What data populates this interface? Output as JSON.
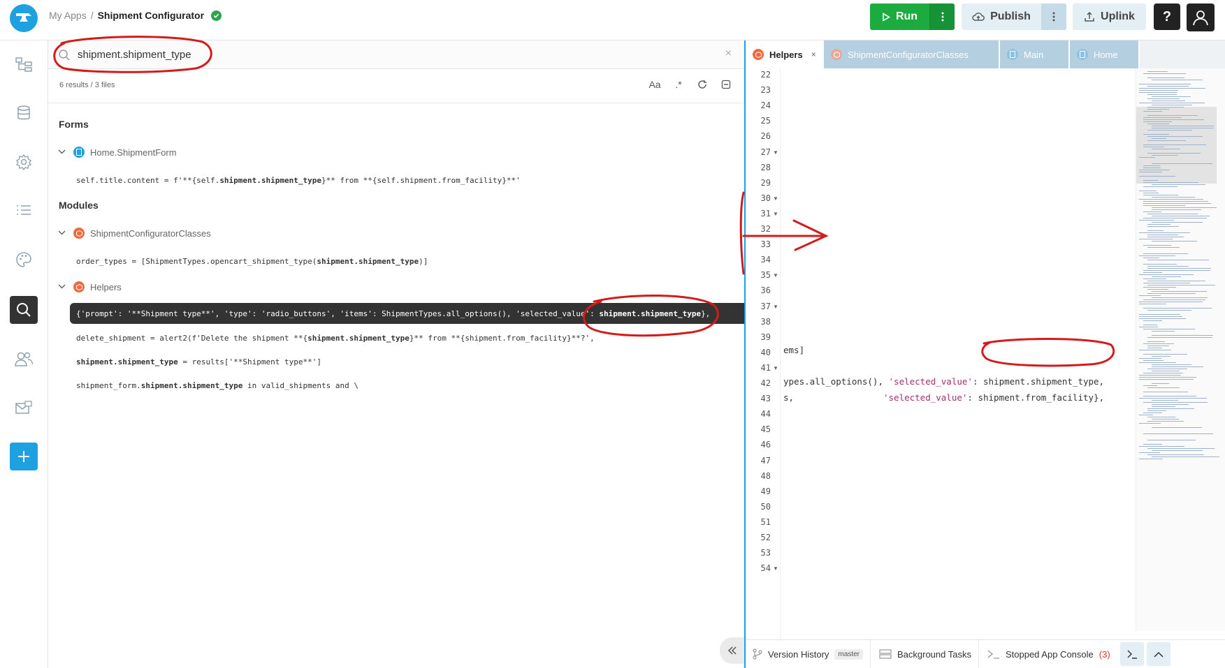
{
  "header": {
    "breadcrumb_root": "My Apps",
    "breadcrumb_sep": "/",
    "app_name": "Shipment Configurator",
    "run_label": "Run",
    "publish_label": "Publish",
    "uplink_label": "Uplink",
    "help_label": "?"
  },
  "search": {
    "query": "shipment.shipment_type",
    "results_summary": "6 results / 3 files",
    "match_case_label": "Aa",
    "regex_label": ".*",
    "sections": {
      "forms": "Forms",
      "modules": "Modules"
    },
    "files": {
      "home_form": "Home.ShipmentForm",
      "classes": "ShipmentConfiguratorClasses",
      "helpers": "Helpers"
    },
    "matches": {
      "m1_a": "self.title.content = f'**{self.",
      "m1_b": "shipment.shipment_type",
      "m1_c": "}** from **{self.shipment.from_facility}**'",
      "m2_a": "order_types = [ShipmentTypes.opencart_shipment_type(",
      "m2_b": "shipment.shipment_type",
      "m2_c": ")]",
      "m3_a": "{'prompt': '**Shipment type**', 'type': 'radio_buttons', 'items': ShipmentTypes.all_options(), 'selected_value': ",
      "m3_b": "shipment.shipment_type",
      "m3_c": "},",
      "m4_a": "delete_shipment = alert2(f'Delete the shipment **{",
      "m4_b": "shipment.shipment_type",
      "m4_c": "}** from **{shipment.from_facility}**?',",
      "m5_b": "shipment.shipment_type",
      "m5_c": " = results['**Shipment type**']",
      "m6_a": "shipment_form.",
      "m6_b": "shipment.shipment_type",
      "m6_c": " in valid_shipments and \\"
    }
  },
  "editor": {
    "tabs": [
      "Helpers",
      "ShipmentConfiguratorClasses",
      "Main",
      "Home"
    ],
    "close_glyph": "×",
    "line_numbers": [
      "22",
      "23",
      "24",
      "25",
      "26",
      "27",
      "28",
      "29",
      "30",
      "31",
      "32",
      "33",
      "34",
      "35",
      "36",
      "37",
      "38",
      "39",
      "40",
      "41",
      "42",
      "43",
      "44",
      "45",
      "46",
      "47",
      "48",
      "49",
      "50",
      "51",
      "52",
      "53",
      "54"
    ],
    "code": {
      "l36": "ems]",
      "l38_a": "ypes.all_options(), ",
      "l38_b": "'selected_value'",
      "l38_c": ": shipment.shipment_type,",
      "l39_a": "s,                 ",
      "l39_b": "'selected_value'",
      "l39_c": ": shipment.from_facility},"
    }
  },
  "statusbar": {
    "version_history": "Version History",
    "branch": "master",
    "background_tasks": "Background Tasks",
    "console": "Stopped App Console",
    "console_count": "(3)"
  },
  "colors": {
    "accent": "#1da1e0",
    "run_green": "#1cab3f",
    "annotation_red": "#d41b1b",
    "module_orange": "#f26a3b"
  }
}
